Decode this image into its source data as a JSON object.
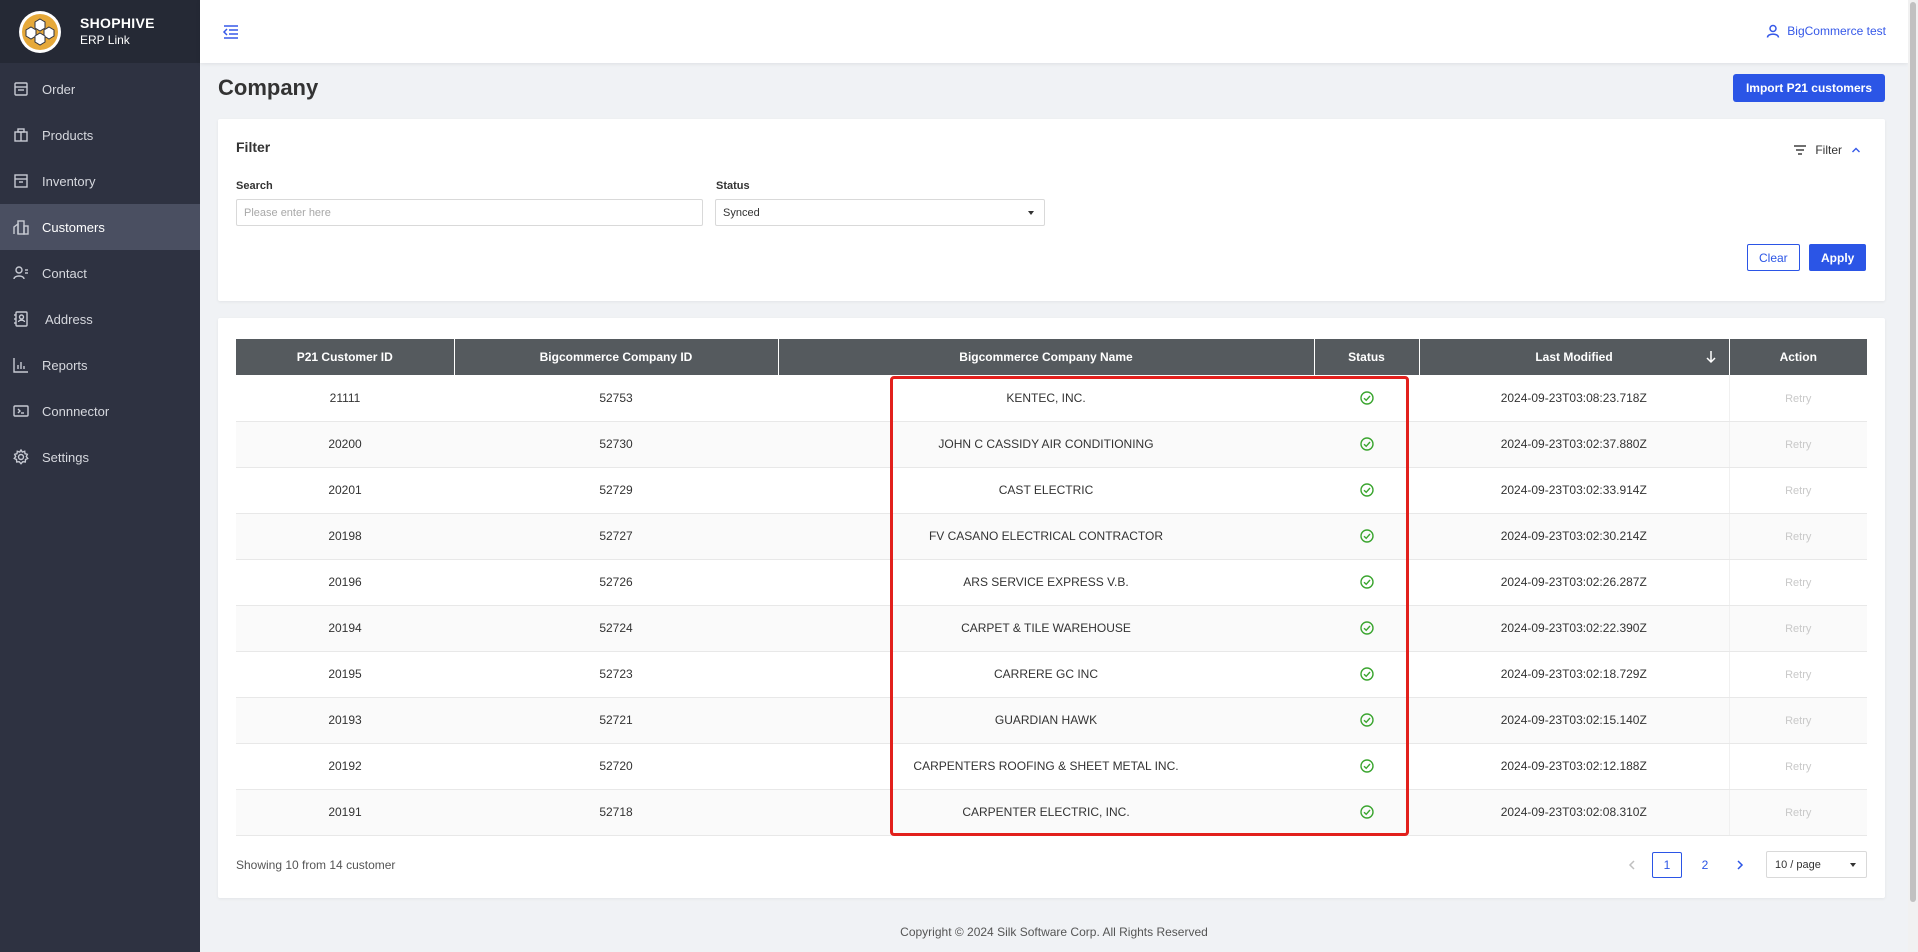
{
  "brand": {
    "title": "SHOPHIVE",
    "subtitle": "ERP Link"
  },
  "sidebar": {
    "items": [
      {
        "label": "Order",
        "icon": "order-icon"
      },
      {
        "label": "Products",
        "icon": "products-icon"
      },
      {
        "label": "Inventory",
        "icon": "inventory-icon"
      },
      {
        "label": "Customers",
        "icon": "customers-icon",
        "active": true
      },
      {
        "label": "Contact",
        "icon": "contact-icon"
      },
      {
        "label": "Address",
        "icon": "address-icon"
      },
      {
        "label": "Reports",
        "icon": "reports-icon"
      },
      {
        "label": "Connnector",
        "icon": "connector-icon"
      },
      {
        "label": "Settings",
        "icon": "settings-icon"
      }
    ]
  },
  "header": {
    "user_name": "BigCommerce test"
  },
  "page": {
    "title": "Company",
    "import_button": "Import P21 customers"
  },
  "filter": {
    "title": "Filter",
    "toggle_label": "Filter",
    "search_label": "Search",
    "search_placeholder": "Please enter here",
    "search_value": "",
    "status_label": "Status",
    "status_value": "Synced",
    "clear_button": "Clear",
    "apply_button": "Apply"
  },
  "table": {
    "columns": [
      "P21 Customer ID",
      "Bigcommerce Company ID",
      "Bigcommerce Company Name",
      "Status",
      "Last Modified",
      "Action"
    ],
    "rows": [
      {
        "p21_id": "21111",
        "bc_id": "52753",
        "name": "KENTEC, INC.",
        "status": "synced",
        "modified": "2024-09-23T03:08:23.718Z",
        "action": "Retry"
      },
      {
        "p21_id": "20200",
        "bc_id": "52730",
        "name": "JOHN C CASSIDY AIR CONDITIONING",
        "status": "synced",
        "modified": "2024-09-23T03:02:37.880Z",
        "action": "Retry"
      },
      {
        "p21_id": "20201",
        "bc_id": "52729",
        "name": "CAST ELECTRIC",
        "status": "synced",
        "modified": "2024-09-23T03:02:33.914Z",
        "action": "Retry"
      },
      {
        "p21_id": "20198",
        "bc_id": "52727",
        "name": "FV CASANO ELECTRICAL CONTRACTOR",
        "status": "synced",
        "modified": "2024-09-23T03:02:30.214Z",
        "action": "Retry"
      },
      {
        "p21_id": "20196",
        "bc_id": "52726",
        "name": "ARS SERVICE EXPRESS V.B.",
        "status": "synced",
        "modified": "2024-09-23T03:02:26.287Z",
        "action": "Retry"
      },
      {
        "p21_id": "20194",
        "bc_id": "52724",
        "name": "CARPET & TILE WAREHOUSE",
        "status": "synced",
        "modified": "2024-09-23T03:02:22.390Z",
        "action": "Retry"
      },
      {
        "p21_id": "20195",
        "bc_id": "52723",
        "name": "CARRERE GC INC",
        "status": "synced",
        "modified": "2024-09-23T03:02:18.729Z",
        "action": "Retry"
      },
      {
        "p21_id": "20193",
        "bc_id": "52721",
        "name": "GUARDIAN HAWK",
        "status": "synced",
        "modified": "2024-09-23T03:02:15.140Z",
        "action": "Retry"
      },
      {
        "p21_id": "20192",
        "bc_id": "52720",
        "name": "CARPENTERS ROOFING & SHEET METAL INC.",
        "status": "synced",
        "modified": "2024-09-23T03:02:12.188Z",
        "action": "Retry"
      },
      {
        "p21_id": "20191",
        "bc_id": "52718",
        "name": "CARPENTER ELECTRIC, INC.",
        "status": "synced",
        "modified": "2024-09-23T03:02:08.310Z",
        "action": "Retry"
      }
    ]
  },
  "pagination": {
    "summary": "Showing 10 from 14 customer",
    "pages": [
      "1",
      "2"
    ],
    "current": "1",
    "page_size": "10 / page"
  },
  "footer": {
    "copyright": "Copyright © 2024 Silk Software Corp. All Rights Reserved"
  },
  "colors": {
    "accent": "#2b55e6",
    "sidebar": "#2e3241",
    "header_row": "#555a5e",
    "success": "#3aa52f",
    "highlight": "#e2201c"
  }
}
